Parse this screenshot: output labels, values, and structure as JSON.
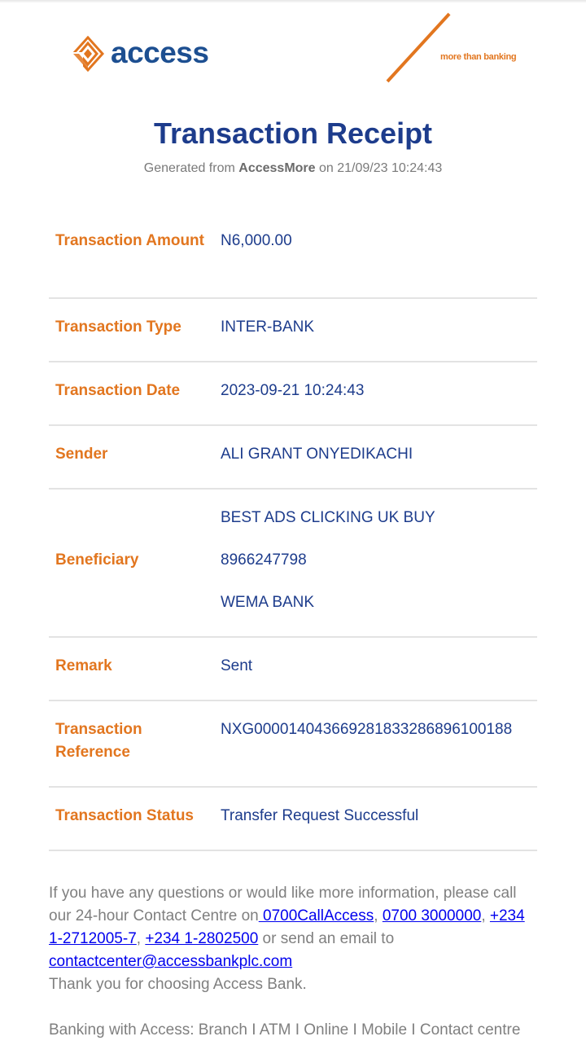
{
  "brand": {
    "logo_text": "access",
    "tagline": "more than banking",
    "orange": "#e2761f",
    "blue": "#1d3c8c"
  },
  "header": {
    "title": "Transaction Receipt",
    "subtitle_prefix": "Generated from",
    "subtitle_app": "AccessMore",
    "subtitle_suffix": "on 21/09/23 10:24:43"
  },
  "details": {
    "amount": {
      "label": "Transaction Amount",
      "value": "N6,000.00"
    },
    "type": {
      "label": "Transaction Type",
      "value": "INTER-BANK"
    },
    "date": {
      "label": "Transaction Date",
      "value": "2023-09-21 10:24:43"
    },
    "sender": {
      "label": "Sender",
      "value": "ALI GRANT ONYEDIKACHI"
    },
    "beneficiary": {
      "label": "Beneficiary",
      "name": "BEST ADS CLICKING UK BUY",
      "account": "8966247798",
      "bank": "WEMA BANK"
    },
    "remark": {
      "label": "Remark",
      "value": "Sent"
    },
    "reference": {
      "label": "Transaction Reference",
      "value": "NXG000014043669281833286896100188"
    },
    "status": {
      "label": "Transaction Status",
      "value": "Transfer Request Successful"
    }
  },
  "footer": {
    "text1": "If you have any questions or would like more information, please call our 24-hour Contact Centre on",
    "link1": " 0700CallAccess",
    "sep1": ", ",
    "link2": "0700 3000000",
    "sep2": ", ",
    "link3": "+234 1-2712005-7",
    "sep3": ", ",
    "link4": "+234 1-2802500",
    "text2": " or send an email to",
    "email": "contactcenter@accessbankplc.com",
    "thanks": "Thank you for choosing Access Bank.",
    "channels": "Banking with Access: Branch I ATM I Online I Mobile I Contact centre"
  }
}
